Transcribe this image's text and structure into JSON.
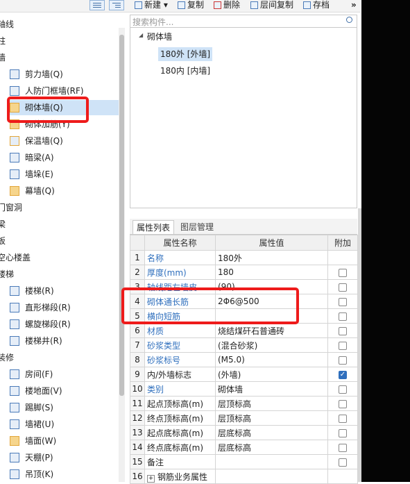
{
  "toolbar": {
    "new": "新建",
    "copy": "复制",
    "delete": "删除",
    "floor_copy": "层间复制",
    "save": "存档",
    "more": "»"
  },
  "left_tree": [
    {
      "label": "轴线",
      "indent": 0,
      "icon": ""
    },
    {
      "label": "柱",
      "indent": 0,
      "icon": ""
    },
    {
      "label": "墙",
      "indent": 0,
      "icon": ""
    },
    {
      "label": "剪力墙(Q)",
      "indent": 1,
      "icon": "shear-wall-icon"
    },
    {
      "label": "人防门框墙(RF)",
      "indent": 1,
      "icon": "civil-defense-door-wall-icon"
    },
    {
      "label": "砌体墙(Q)",
      "indent": 1,
      "icon": "masonry-wall-icon",
      "selected": true
    },
    {
      "label": "砌体加筋(Y)",
      "indent": 1,
      "icon": "masonry-reinforcement-icon"
    },
    {
      "label": "保温墙(Q)",
      "indent": 1,
      "icon": "insulation-wall-icon"
    },
    {
      "label": "暗梁(A)",
      "indent": 1,
      "icon": "hidden-beam-icon"
    },
    {
      "label": "墙垛(E)",
      "indent": 1,
      "icon": "wall-pier-icon"
    },
    {
      "label": "幕墙(Q)",
      "indent": 1,
      "icon": "curtain-wall-icon"
    },
    {
      "label": "门窗洞",
      "indent": 0,
      "icon": ""
    },
    {
      "label": "梁",
      "indent": 0,
      "icon": ""
    },
    {
      "label": "板",
      "indent": 0,
      "icon": ""
    },
    {
      "label": "空心楼盖",
      "indent": 0,
      "icon": ""
    },
    {
      "label": "楼梯",
      "indent": 0,
      "icon": ""
    },
    {
      "label": "楼梯(R)",
      "indent": 1,
      "icon": "stair-icon"
    },
    {
      "label": "直形梯段(R)",
      "indent": 1,
      "icon": "straight-flight-icon"
    },
    {
      "label": "螺旋梯段(R)",
      "indent": 1,
      "icon": "spiral-flight-icon"
    },
    {
      "label": "楼梯井(R)",
      "indent": 1,
      "icon": "stairwell-icon"
    },
    {
      "label": "装修",
      "indent": 0,
      "icon": ""
    },
    {
      "label": "房间(F)",
      "indent": 1,
      "icon": "room-icon"
    },
    {
      "label": "楼地面(V)",
      "indent": 1,
      "icon": "floor-icon"
    },
    {
      "label": "踢脚(S)",
      "indent": 1,
      "icon": "skirting-icon"
    },
    {
      "label": "墙裙(U)",
      "indent": 1,
      "icon": "dado-icon"
    },
    {
      "label": "墙面(W)",
      "indent": 1,
      "icon": "wall-face-icon"
    },
    {
      "label": "天棚(P)",
      "indent": 1,
      "icon": "ceiling-icon"
    },
    {
      "label": "吊顶(K)",
      "indent": 1,
      "icon": "suspended-ceiling-icon"
    }
  ],
  "search": {
    "placeholder": "搜索构件..."
  },
  "component_tree": {
    "group": "砌体墙",
    "items": [
      {
        "label": "180外 [外墙]",
        "selected": true
      },
      {
        "label": "180内 [内墙]",
        "selected": false
      }
    ]
  },
  "property_tabs": [
    "属性列表",
    "图层管理"
  ],
  "property_headers": [
    "属性名称",
    "属性值",
    "附加"
  ],
  "properties": [
    {
      "no": "1",
      "name": "名称",
      "value": "180外",
      "blue": true,
      "checkbox": "none"
    },
    {
      "no": "2",
      "name": "厚度(mm)",
      "value": "180",
      "blue": true,
      "checkbox": "off"
    },
    {
      "no": "3",
      "name": "轴线距左墙皮...",
      "value": "(90)",
      "blue": true,
      "checkbox": "off"
    },
    {
      "no": "4",
      "name": "砌体通长筋",
      "value": "2Φ6@500",
      "blue": true,
      "checkbox": "off"
    },
    {
      "no": "5",
      "name": "横向短筋",
      "value": "",
      "blue": true,
      "checkbox": "off"
    },
    {
      "no": "6",
      "name": "材质",
      "value": "烧结煤矸石普通砖",
      "blue": true,
      "checkbox": "off"
    },
    {
      "no": "7",
      "name": "砂浆类型",
      "value": "(混合砂浆)",
      "blue": true,
      "checkbox": "off"
    },
    {
      "no": "8",
      "name": "砂浆标号",
      "value": "(M5.0)",
      "blue": true,
      "checkbox": "off"
    },
    {
      "no": "9",
      "name": "内/外墙标志",
      "value": "(外墙)",
      "blue": false,
      "checkbox": "on"
    },
    {
      "no": "10",
      "name": "类别",
      "value": "砌体墙",
      "blue": true,
      "checkbox": "off"
    },
    {
      "no": "11",
      "name": "起点顶标高(m)",
      "value": "层顶标高",
      "blue": false,
      "checkbox": "off"
    },
    {
      "no": "12",
      "name": "终点顶标高(m)",
      "value": "层顶标高",
      "blue": false,
      "checkbox": "off"
    },
    {
      "no": "13",
      "name": "起点底标高(m)",
      "value": "层底标高",
      "blue": false,
      "checkbox": "off"
    },
    {
      "no": "14",
      "name": "终点底标高(m)",
      "value": "层底标高",
      "blue": false,
      "checkbox": "off"
    },
    {
      "no": "15",
      "name": "备注",
      "value": "",
      "blue": false,
      "checkbox": "off"
    },
    {
      "no": "16",
      "name": "钢筋业务属性",
      "value": "",
      "blue": false,
      "checkbox": "none",
      "expand": "+"
    }
  ],
  "colors": {
    "highlight_red": "#ee1b1b",
    "link_blue": "#2f6fbd",
    "selection": "#cfe3f7"
  }
}
